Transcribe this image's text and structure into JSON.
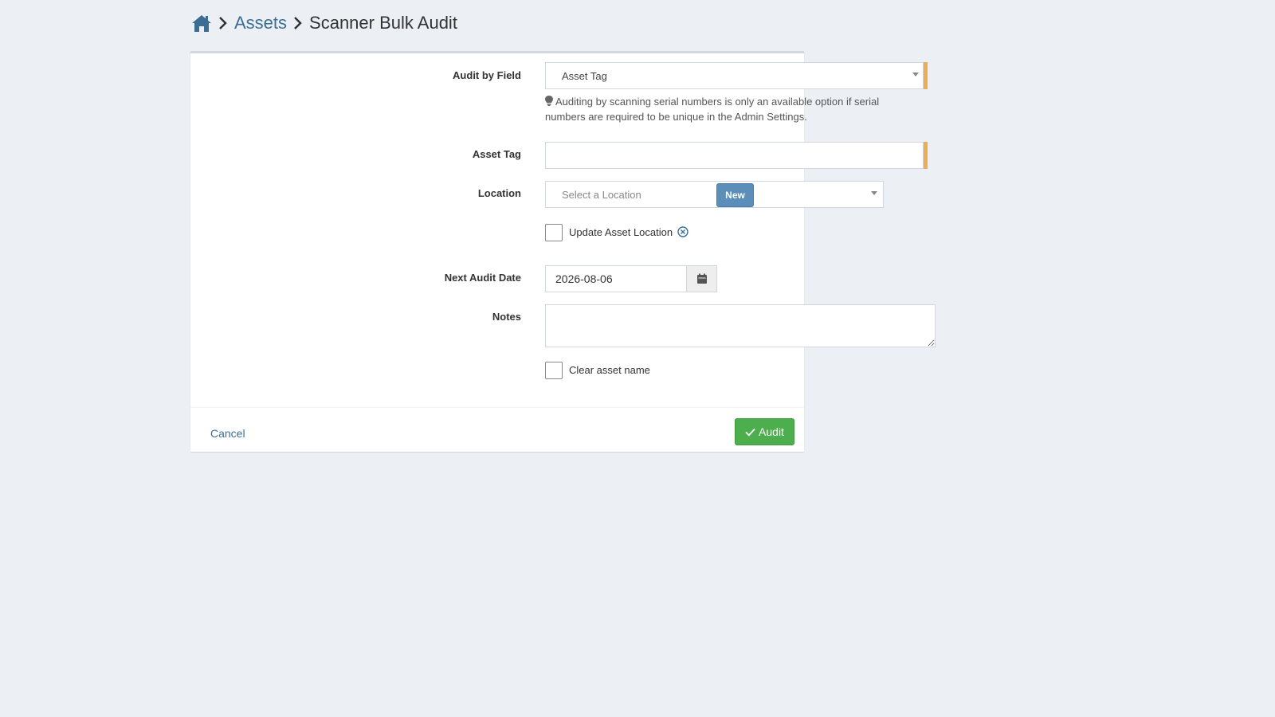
{
  "breadcrumb": {
    "home_icon": "home-icon",
    "assets_label": "Assets",
    "current_label": "Scanner Bulk Audit"
  },
  "form": {
    "audit_by_field": {
      "label": "Audit by Field",
      "value": "Asset Tag",
      "help": "Auditing by scanning serial numbers is only an available option if serial numbers are required to be unique in the Admin Settings."
    },
    "asset_tag": {
      "label": "Asset Tag",
      "value": ""
    },
    "location": {
      "label": "Location",
      "placeholder": "Select a Location",
      "new_button": "New"
    },
    "update_location": {
      "label": "Update Asset Location",
      "checked": false
    },
    "next_audit_date": {
      "label": "Next Audit Date",
      "value": "2026-08-06"
    },
    "notes": {
      "label": "Notes",
      "value": ""
    },
    "clear_asset_name": {
      "label": "Clear asset name",
      "checked": false
    }
  },
  "footer": {
    "cancel_label": "Cancel",
    "audit_label": "Audit"
  },
  "colors": {
    "background": "#ecf0f5",
    "link": "#3c6e93",
    "required": "#f0ad4e",
    "primary": "#5b8fba",
    "success": "#4cae4c"
  }
}
